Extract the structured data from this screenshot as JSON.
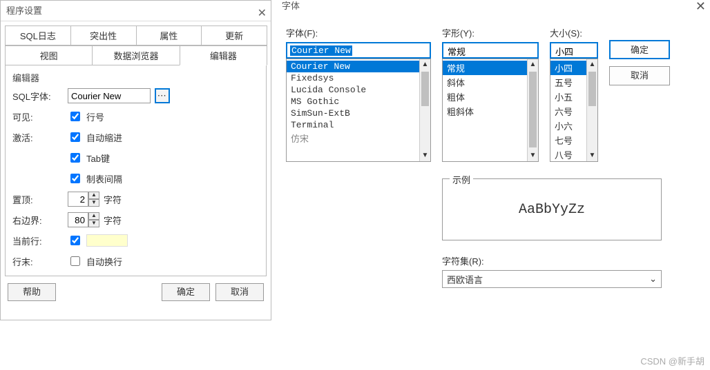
{
  "left": {
    "title": "程序设置",
    "tabs1": [
      "SQL日志",
      "突出性",
      "属性",
      "更新"
    ],
    "tabs2": [
      "视图",
      "数据浏览器",
      "编辑器"
    ],
    "group": "编辑器",
    "rows": {
      "sqlfont_label": "SQL字体:",
      "sqlfont_value": "Courier New",
      "visible_label": "可见:",
      "linenum": "行号",
      "active_label": "激活:",
      "autoindent": "自动缩进",
      "tabkey": "Tab键",
      "tabspace": "制表间隔",
      "top_label": "置顶:",
      "top_val": "2",
      "chars": "字符",
      "rmargin_label": "右边界:",
      "rmargin_val": "80",
      "curline_label": "当前行:",
      "eol_label": "行末:",
      "autowrap": "自动换行"
    },
    "buttons": {
      "help": "帮助",
      "ok": "确定",
      "cancel": "取消"
    }
  },
  "right": {
    "title": "字体",
    "labels": {
      "font": "字体(F):",
      "style": "字形(Y):",
      "size": "大小(S):",
      "sample": "示例",
      "charset": "字符集(R):"
    },
    "font_value": "Courier New",
    "fonts": [
      "Courier New",
      "Fixedsys",
      "Lucida Console",
      "MS Gothic",
      "SimSun-ExtB",
      "Terminal",
      "仿宋"
    ],
    "style_value": "常规",
    "styles": [
      "常规",
      "斜体",
      "粗体",
      "粗斜体"
    ],
    "size_value": "小四",
    "sizes": [
      "小四",
      "五号",
      "小五",
      "六号",
      "小六",
      "七号",
      "八号"
    ],
    "buttons": {
      "ok": "确定",
      "cancel": "取消"
    },
    "sample_text": "AaBbYyZz",
    "charset_value": "西欧语言"
  },
  "watermark": "CSDN @新手胡"
}
